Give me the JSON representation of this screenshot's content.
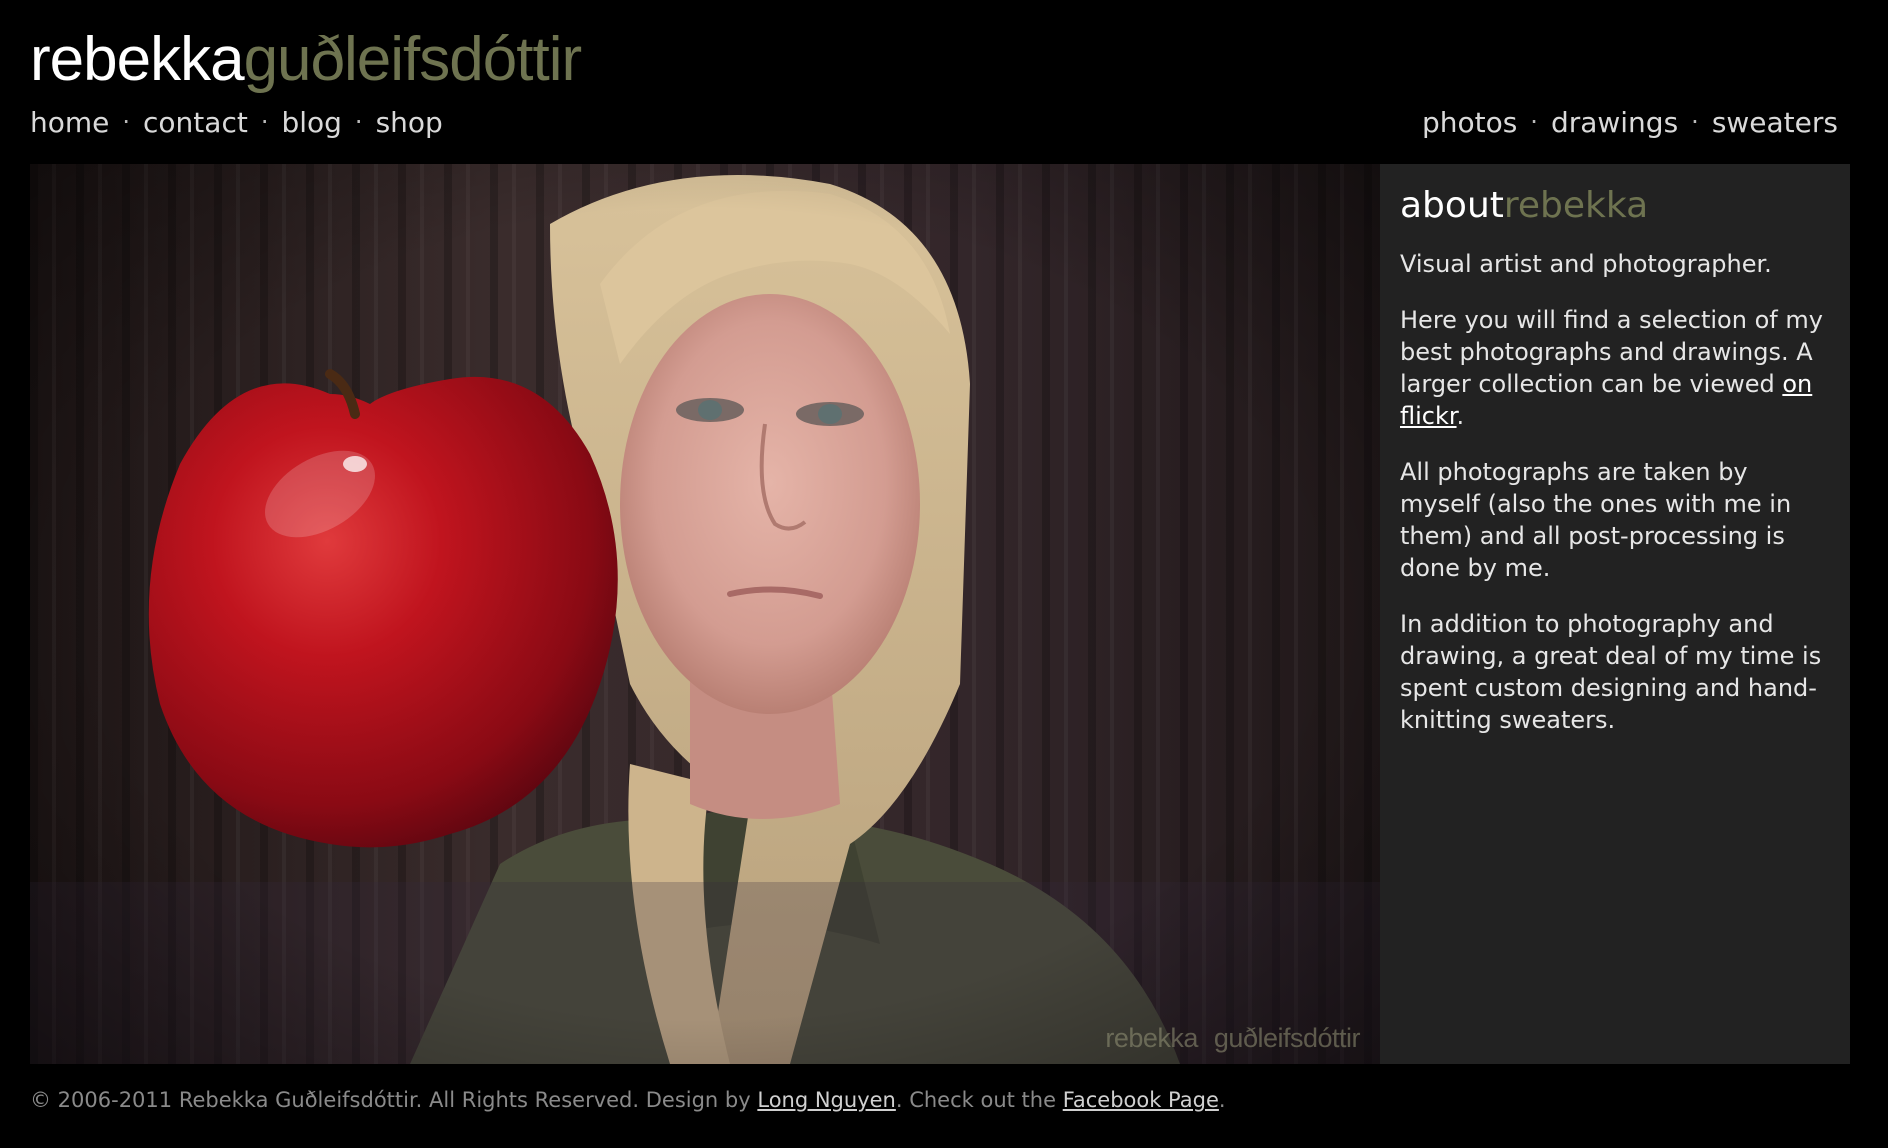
{
  "site": {
    "logo_first": "rebekka",
    "logo_last": "guðleifsdóttir"
  },
  "nav_left": [
    {
      "label": "home"
    },
    {
      "label": "contact"
    },
    {
      "label": "blog"
    },
    {
      "label": "shop"
    }
  ],
  "nav_right": [
    {
      "label": "photos"
    },
    {
      "label": "drawings"
    },
    {
      "label": "sweaters"
    }
  ],
  "nav_separator": "·",
  "hero": {
    "watermark_first": "rebekka",
    "watermark_last": "guðleifsdóttir"
  },
  "about": {
    "title_a": "about",
    "title_b": "rebekka",
    "p1": "Visual artist and photographer.",
    "p2_before": "Here you will find a selection of my best photographs and drawings. A larger collection can be viewed ",
    "p2_link": "on flickr",
    "p2_after": ".",
    "p3": "All photographs are taken by myself (also the ones with me in them) and all post-processing is done by me.",
    "p4": "In addition to photography and drawing, a great deal of my time is spent custom designing and hand-knitting sweaters."
  },
  "footer": {
    "text_before": "© 2006-2011 Rebekka Guðleifsdóttir. All Rights Reserved. Design by ",
    "designer_link": "Long Nguyen",
    "text_middle": ". Check out the ",
    "facebook_link": "Facebook Page",
    "text_after": "."
  },
  "colors": {
    "background": "#000000",
    "accent_olive": "#6e7350",
    "sidebar_bg": "#222222",
    "apple_red": "#b0101c"
  }
}
